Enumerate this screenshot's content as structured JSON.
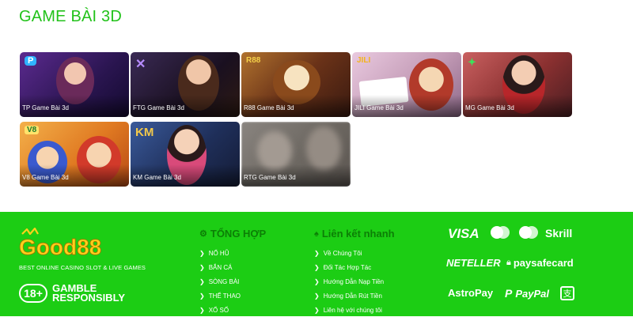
{
  "section": {
    "title": "GAME BÀI 3D"
  },
  "games": [
    {
      "label": "TP Game Bài 3d",
      "badge": "P",
      "bg": "#3b1f63"
    },
    {
      "label": "FTG Game Bài 3d",
      "badge": "",
      "bg": "#2a1835"
    },
    {
      "label": "R88 Game Bài 3d",
      "badge": "R88",
      "bg": "#7a3a14"
    },
    {
      "label": "JILI Game Bài 3d",
      "badge": "JILI",
      "bg": "#c7a0bb"
    },
    {
      "label": "MG Game Bài 3d",
      "badge": "",
      "bg": "#a84a4a"
    },
    {
      "label": "V8 Game Bài 3d",
      "badge": "V8",
      "bg": "#e08a2a"
    },
    {
      "label": "KM Game Bài 3d",
      "badge": "KM",
      "bg": "#2b3f6e"
    },
    {
      "label": "RTG Game Bài 3d",
      "badge": "",
      "bg": "#7b756e"
    }
  ],
  "footer": {
    "logo": "Good88",
    "tagline": "BEST ONLINE CASINO SLOT & LIVE GAMES",
    "age_badge": "18+",
    "gamble_line1": "GAMBLE",
    "gamble_line2": "RESPONSIBLY",
    "col1": {
      "title": "TỔNG HỢP",
      "items": [
        "NỔ HŨ",
        "BẮN CÁ",
        "SÒNG BÀI",
        "THỂ THAO",
        "XỔ SỐ"
      ]
    },
    "col2": {
      "title": "Liên kết nhanh",
      "items": [
        "Về Chúng Tôi",
        "Đối Tác Hợp Tác",
        "Hướng Dẫn Nạp Tiền",
        "Hướng Dẫn Rút Tiền",
        "Liên hệ với chúng tôi"
      ]
    },
    "payments": {
      "visa": "VISA",
      "skrill": "Skrill",
      "neteller": "NETELLER",
      "paysafe": "paysafecard",
      "astropay": "AstroPay",
      "paypal": "PayPal"
    }
  },
  "colors": {
    "accent": "#22c21a",
    "footer_bg": "#1ccd14"
  }
}
